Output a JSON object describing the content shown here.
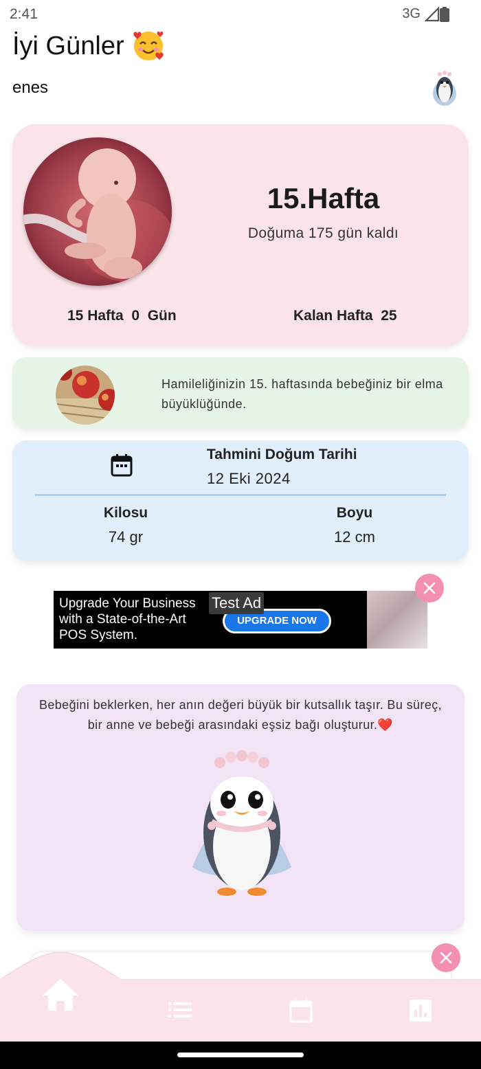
{
  "status_bar": {
    "time": "2:41",
    "network": "3G"
  },
  "header": {
    "greeting": "İyi Günler",
    "greeting_emoji": "🥰",
    "username": "enes",
    "avatar_icon": "penguin-avatar-icon"
  },
  "week_card": {
    "week_title": "15.Hafta",
    "days_left": "Doğuma 175 gün kaldı",
    "elapsed": "15 Hafta  0  Gün",
    "remaining": "Kalan Hafta  25"
  },
  "size_card": {
    "text": "Hamileliğinizin 15. haftasında bebeğiniz bir elma büyüklüğünde."
  },
  "due_card": {
    "title": "Tahmini Doğum Tarihi",
    "date": "12 Eki 2024",
    "weight_label": "Kilosu",
    "weight_value": "74 gr",
    "length_label": "Boyu",
    "length_value": "12 cm"
  },
  "ad": {
    "copy": "Upgrade Your Business with a State-of-the-Art POS System.",
    "badge": "Test Ad",
    "cta": "UPGRADE NOW"
  },
  "quote_card": {
    "text": "Bebeğini beklerken, her anın değeri büyük bir kutsallık taşır. Bu süreç, bir anne ve bebeği arasındaki eşsiz bağı oluşturur.❤️"
  },
  "bottom_nav": {
    "items": [
      {
        "icon": "home-icon",
        "active": true
      },
      {
        "icon": "list-icon",
        "active": false
      },
      {
        "icon": "calendar-icon",
        "active": false
      },
      {
        "icon": "chart-icon",
        "active": false
      }
    ]
  },
  "colors": {
    "week_card_bg": "#fbe3ea",
    "size_card_bg": "#e7f4e8",
    "due_card_bg": "#e1effd",
    "quote_card_bg": "#f2e3f6",
    "accent_pink": "#f38fb0",
    "nav_bg": "#fbe3ea"
  }
}
